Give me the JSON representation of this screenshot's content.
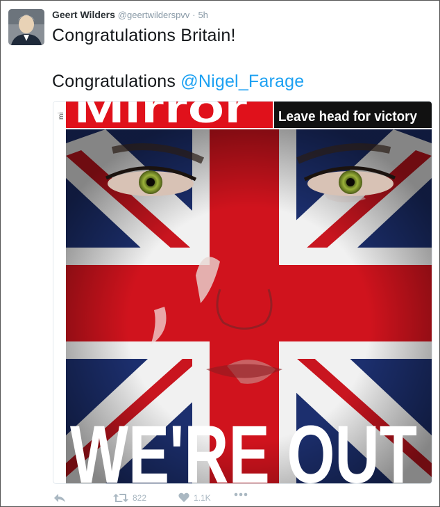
{
  "tweet": {
    "author_name": "Geert Wilders",
    "handle": "@geertwilderspvv",
    "separator": "·",
    "time": "5h",
    "line1": "Congratulations Britain!",
    "line2_prefix": "Congratulations ",
    "mention": "@Nigel_Farage"
  },
  "media": {
    "masthead": "Mirror",
    "site_stub": "mi",
    "strap": "Leave head for victory",
    "headline": "WE'RE OUT"
  },
  "actions": {
    "reply_icon": "reply-icon",
    "retweet_icon": "retweet-icon",
    "retweet_count": "822",
    "like_icon": "heart-icon",
    "like_count": "1.1K",
    "more_icon": "more-icon"
  },
  "colors": {
    "mention": "#1da1f2",
    "icon_gray": "#aab8c2",
    "mirror_red": "#e0111b",
    "flag_blue": "#1c2f6e"
  }
}
